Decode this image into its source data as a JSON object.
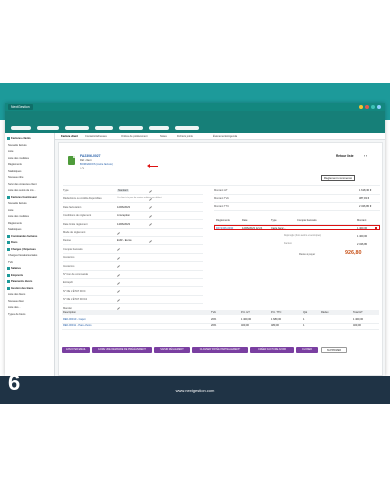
{
  "app": {
    "brand": "NextGestion"
  },
  "colors": {
    "teal": "#1d9a9a",
    "accent_orange": "#c8531a",
    "button_purple": "#7a3fa1",
    "footer": "#1f3345",
    "highlight_red": "#dd1111"
  },
  "sidebar": {
    "items": [
      {
        "label": "Factures clients",
        "head": true
      },
      {
        "label": "Nouvelle facture"
      },
      {
        "label": "Liste"
      },
      {
        "label": "Liste des modèles"
      },
      {
        "label": "Règlements"
      },
      {
        "label": "Statistiques"
      },
      {
        "label": "Nouveau titre"
      },
      {
        "label": "Suivi des créances client"
      },
      {
        "label": "Liste des suivis de cré..."
      },
      {
        "label": "Factures fournisseur",
        "head": true
      },
      {
        "label": "Nouvelle facture"
      },
      {
        "label": "Liste"
      },
      {
        "label": "Liste des modèles"
      },
      {
        "label": "Règlements"
      },
      {
        "label": "Statistiques"
      },
      {
        "label": "Commandes factures",
        "head": true
      },
      {
        "label": "Dons",
        "head": true
      },
      {
        "label": "Charges | Dépenses",
        "head": true
      },
      {
        "label": "Charges fiscales/sociales"
      },
      {
        "label": "TVA"
      },
      {
        "label": "Salaires",
        "head": true
      },
      {
        "label": "Emprunts",
        "head": true
      },
      {
        "label": "Paiements divers",
        "head": true
      },
      {
        "label": "Gestion des biens",
        "head": true
      },
      {
        "label": "Liste des biens"
      },
      {
        "label": "Nouveau bien"
      },
      {
        "label": "Liste des..."
      },
      {
        "label": "Types de biens"
      }
    ]
  },
  "tabs": [
    {
      "label": "Facture client",
      "active": true
    },
    {
      "label": "Contacts/Adresses"
    },
    {
      "label": "Ordres de prélèvement"
    },
    {
      "label": "Notes"
    },
    {
      "label": "Fichiers joints"
    },
    {
      "label": "Événements/Agenda"
    }
  ],
  "invoice": {
    "ref": "FA2306-0027",
    "ref_client": "Réf. client",
    "company": "BORNADOIS (Autre facture)",
    "back_label": "Retour liste",
    "status_label": "Règlement commencé"
  },
  "fields": [
    {
      "label": "Type",
      "value": "Standard"
    },
    {
      "label": "Réductions ou crédits disponibles",
      "value": "Ce client n'a pas de remise relative par défaut"
    },
    {
      "label": "Date facturation",
      "value": "12/06/2023"
    },
    {
      "label": "Conditions de règlement",
      "value": "A réception"
    },
    {
      "label": "Date limite règlement",
      "value": "14/06/2023"
    },
    {
      "label": "Mode de règlement",
      "value": ""
    },
    {
      "label": "Devise",
      "value": "EUR - Euros"
    },
    {
      "label": "Compte bancaire",
      "value": ""
    },
    {
      "label": "Incoterms",
      "value": ""
    },
    {
      "label": "Incoterms",
      "value": ""
    },
    {
      "label": "N° bon de commande",
      "value": ""
    },
    {
      "label": "Entrepôt",
      "value": ""
    },
    {
      "label": "N° DE L'ÉTAT DOC",
      "value": ""
    },
    {
      "label": "N° DE L'ÉTAT DOC2",
      "value": ""
    },
    {
      "label": "Mandat",
      "value": ""
    }
  ],
  "amounts": [
    {
      "label": "Montant HT",
      "value": "1 618,30 €"
    },
    {
      "label": "Montant TVA",
      "value": "387,93 €"
    },
    {
      "label": "Montant TTC",
      "value": "2 326,80 €"
    }
  ],
  "payments": {
    "headers": [
      "Règlements",
      "Date",
      "Type",
      "Compte bancaire",
      "Montant"
    ],
    "rows": [
      {
        "ref": "PAY2306-0030",
        "date": "12/06/2023 12:24",
        "type": "Carte banc...",
        "account": "",
        "amount": "1 400,00"
      }
    ],
    "deja_regle_label": "Déjà réglé (hors avoirs et acomptes)",
    "deja_regle": "1 400,00",
    "facture_label": "Facturé",
    "facture": "2 326,80",
    "reste_label": "Reste à payer",
    "reste": "926,80"
  },
  "lines": {
    "headers": [
      "Description",
      "TVA",
      "P.U. HT",
      "P.U. TTC",
      "Qté",
      "Réduc.",
      "Total HT"
    ],
    "rows": [
      {
        "desc": "REF-00010 - Capot",
        "tva": "20%",
        "pu_ht": "1 400,00",
        "pu_ttc": "1 680,00",
        "qty": "1",
        "reduc": "",
        "total": "1 400,00"
      },
      {
        "desc": "REF-00011 - Pare-chocs",
        "tva": "20%",
        "pu_ht": "400,00",
        "pu_ttc": "480,00",
        "qty": "1",
        "reduc": "",
        "total": "400,00"
      }
    ]
  },
  "actions": [
    "ENVOYER EMAIL",
    "FAIRE UNE DEMANDE DE PRÉLÈVEMENT",
    "SAISIR RÈGLEMENT",
    "CLASSER 'PAYÉE PARTIELLEMENT'",
    "CRÉER FACTURE AVOIR",
    "CLONER",
    "SUPPRIMER"
  ],
  "footer": {
    "step": "6",
    "website": "www.nextgestion.com"
  }
}
